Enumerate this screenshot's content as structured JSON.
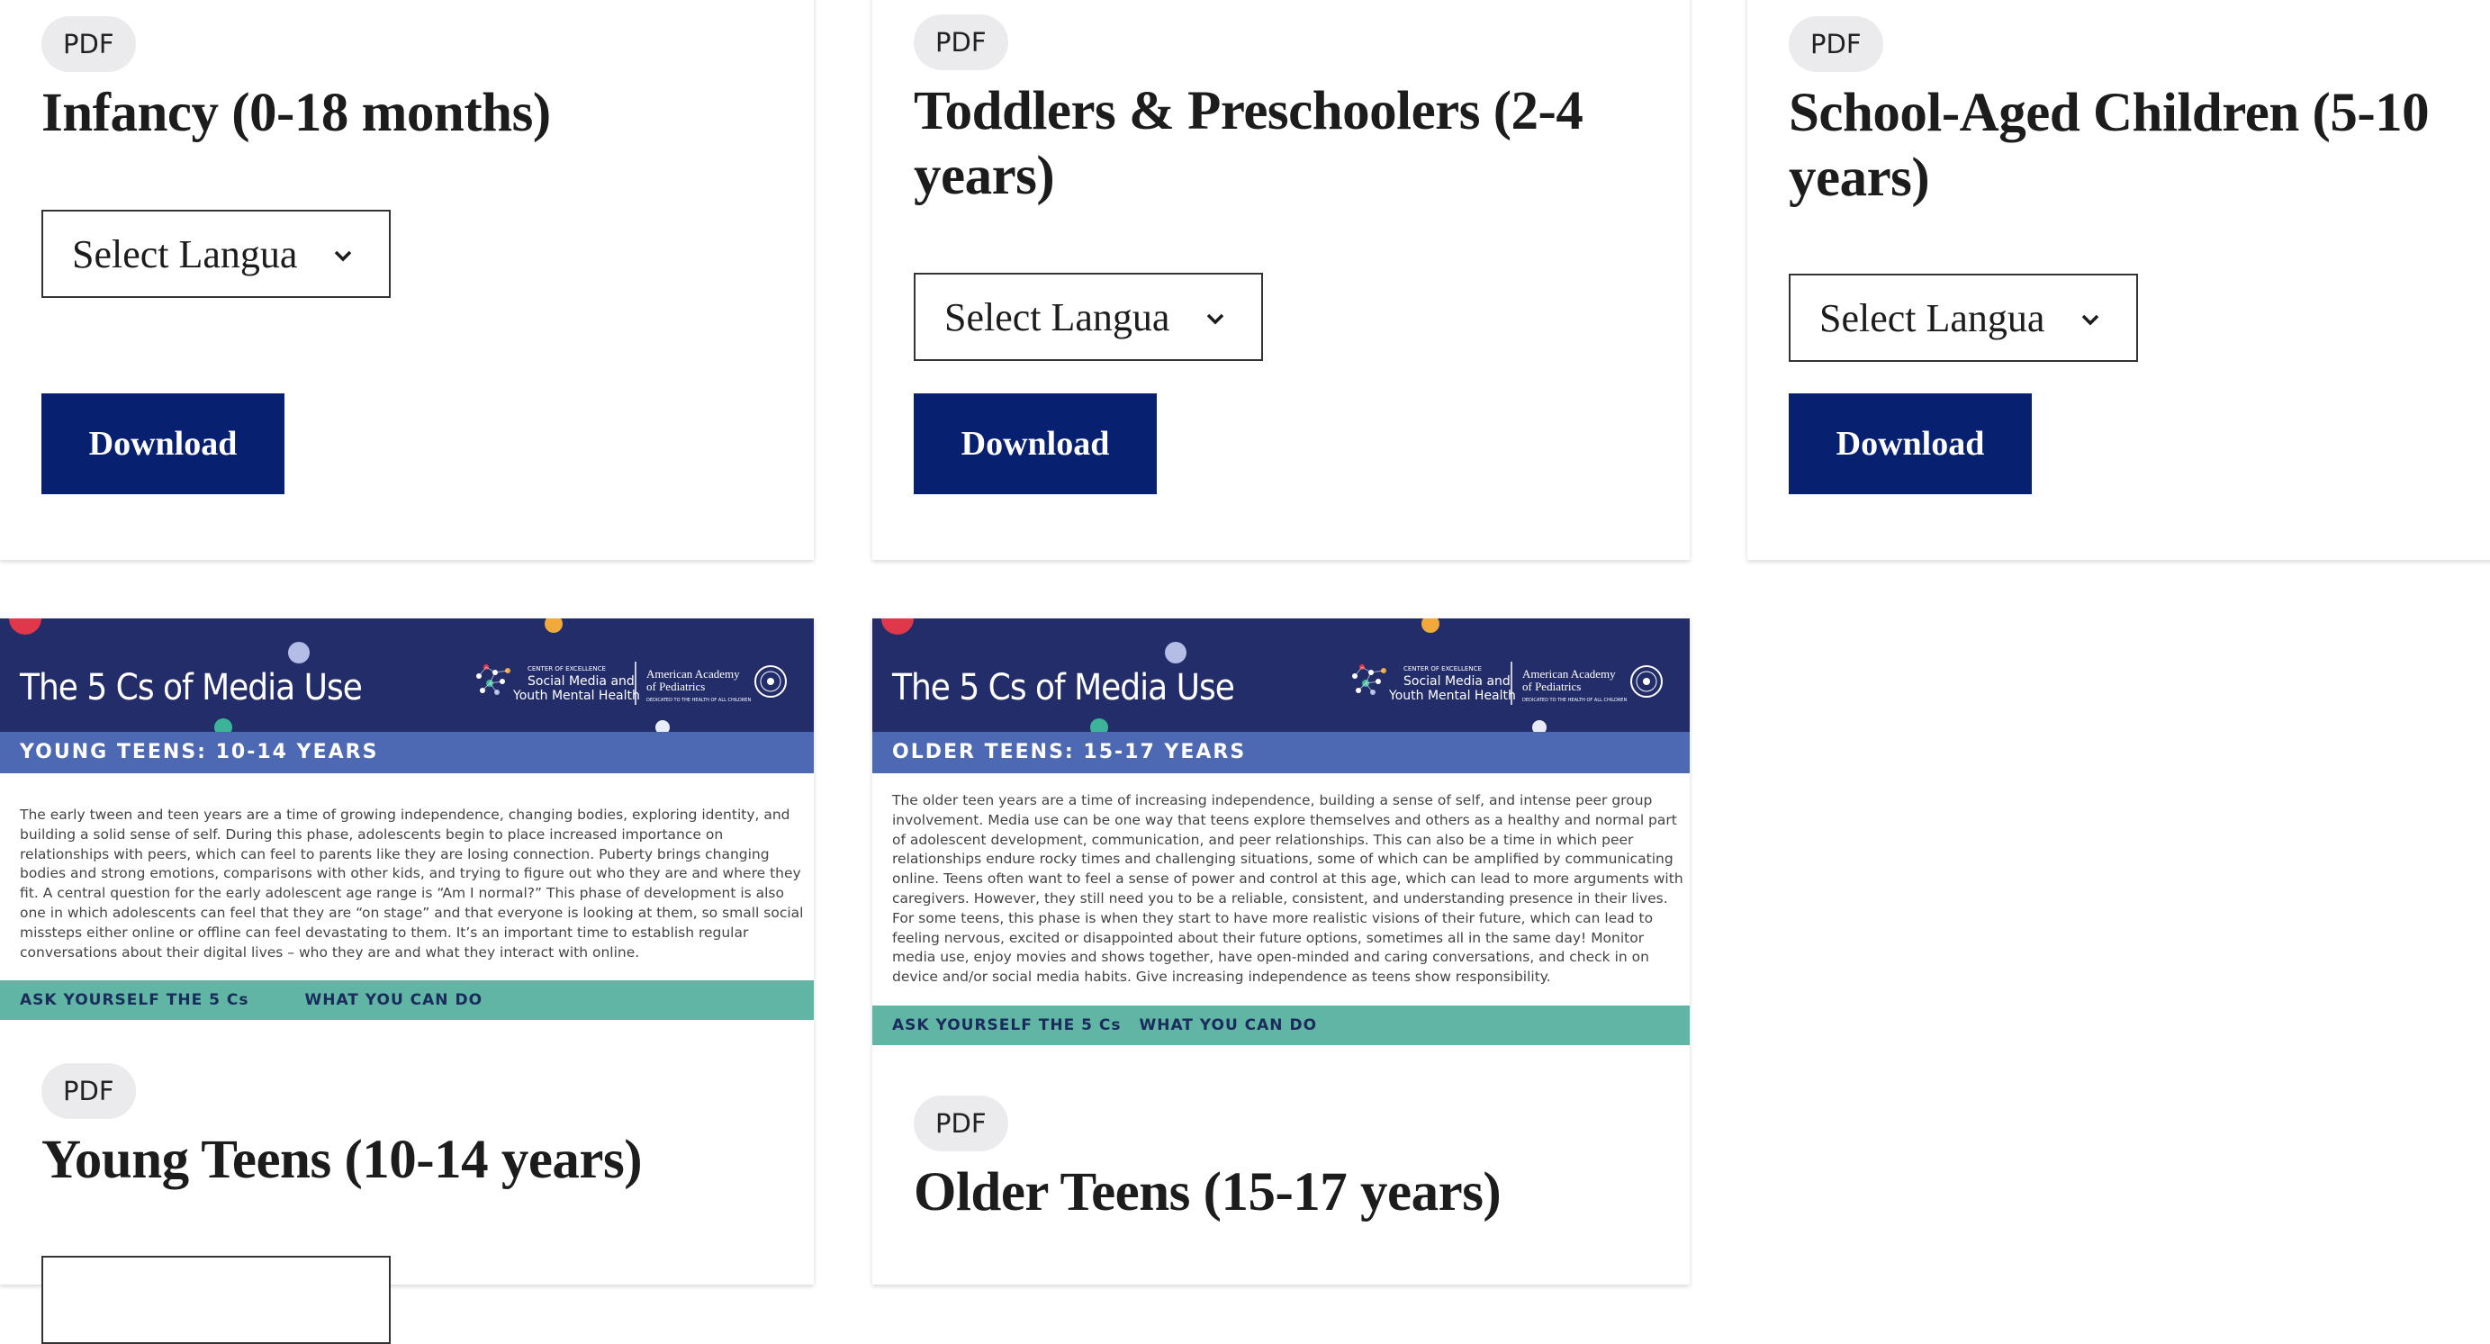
{
  "cards": [
    {
      "badge": "PDF",
      "title": "Infancy (0-18 months)",
      "select_label": "Select Langua",
      "download_label": "Download"
    },
    {
      "badge": "PDF",
      "title": "Toddlers & Preschoolers (2-4 years)",
      "select_label": "Select Langua",
      "download_label": "Download"
    },
    {
      "badge": "PDF",
      "title": "School-Aged Children (5-10 years)",
      "select_label": "Select Langua",
      "download_label": "Download"
    },
    {
      "badge": "PDF",
      "title": "Young Teens (10-14 years)",
      "thumb": {
        "title": "The 5 Cs of Media Use",
        "logo_small": "CENTER OF EXCELLENCE",
        "logo_name_1": "Social Media and",
        "logo_name_2": "Youth Mental Health",
        "aap_1": "American Academy",
        "aap_2": "of Pediatrics",
        "aap_tagline": "DEDICATED TO THE HEALTH OF ALL CHILDREN",
        "band": "YOUNG TEENS: 10-14 YEARS",
        "body": "The early tween and teen years are a time of growing independence, changing bodies, exploring identity, and building a solid sense of self. During this phase, adolescents begin to place increased importance on relationships with peers, which can feel to parents like they are losing connection.  Puberty brings changing bodies and strong emotions, comparisons with other kids, and trying to figure out who they are and where they fit. A central question for the early adolescent age range is “Am I normal?” This phase of development is also one in which adolescents can feel that they are “on stage” and that everyone is looking at them, so small social missteps either online or offline can feel devastating to them. It’s an important time to establish regular conversations about their digital lives – who they are and what they interact with online.",
        "ask": "ASK YOURSELF THE 5 Cs",
        "what": "WHAT YOU CAN DO"
      }
    },
    {
      "badge": "PDF",
      "title": "Older Teens (15-17 years)",
      "thumb": {
        "title": "The 5 Cs of Media Use",
        "logo_small": "CENTER OF EXCELLENCE",
        "logo_name_1": "Social Media and",
        "logo_name_2": "Youth Mental Health",
        "aap_1": "American Academy",
        "aap_2": "of Pediatrics",
        "aap_tagline": "DEDICATED TO THE HEALTH OF ALL CHILDREN",
        "band": "OLDER TEENS: 15-17 YEARS",
        "body": "The older teen years are a time of increasing independence, building a sense of self, and intense peer group involvement. Media use can be one way that teens explore themselves and others as a healthy and normal part of adolescent development, communication, and peer relationships. This can also be a time in which peer relationships endure rocky times and challenging situations, some of which can be amplified by communicating online. Teens often want to feel a sense of power and control at this age, which can lead to more arguments with caregivers. However, they still need you to be a reliable, consistent, and understanding presence in their lives. For some teens, this phase is when they start to have more realistic visions of their future, which can lead to feeling nervous, excited or disappointed about their future options, sometimes all in the same day! Monitor media use, enjoy movies and shows together, have open-minded and caring conversations, and check in on device and/or social media habits. Give increasing independence as teens show responsibility.",
        "ask": "ASK YOURSELF THE 5 Cs",
        "what": "WHAT YOU CAN DO"
      }
    }
  ],
  "colors": {
    "button_bg": "#082070",
    "thumb_header": "#232d6a",
    "thumb_band": "#4d69b4",
    "thumb_green": "#60b5a5",
    "dot_red": "#e0384a",
    "dot_orange": "#f2a93b",
    "dot_lavender": "#b3bde6",
    "dot_teal": "#3db39a",
    "badge_bg": "#ebebed"
  },
  "icons": {
    "select_chevron": "chevron-down-icon",
    "aap_seal": "aap-seal-icon",
    "network_logo": "network-logo-icon"
  }
}
